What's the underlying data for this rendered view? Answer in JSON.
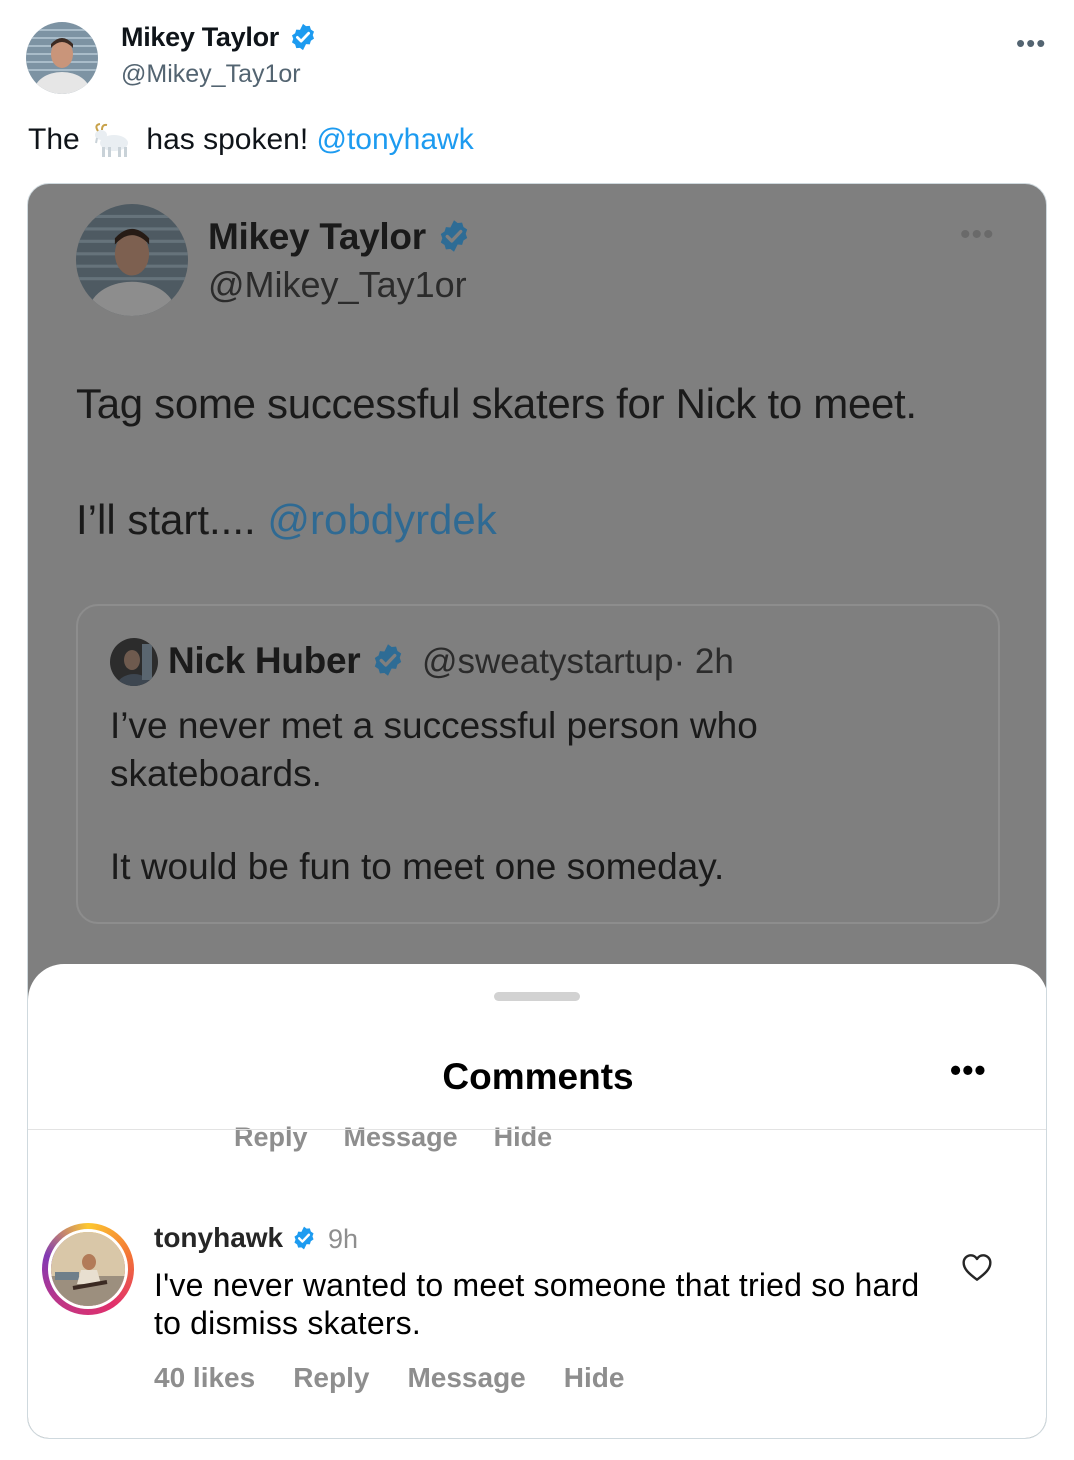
{
  "tweet": {
    "author_name": "Mikey Taylor",
    "author_handle": "@Mikey_Tay1or",
    "more_icon": "more-horizontal-icon",
    "text_before": "The",
    "emoji_icon": "goat-emoji-icon",
    "text_after": "has spoken!",
    "mention": "@tonyhawk",
    "colors": {
      "link": "#1d9bf0",
      "verified": "#1d9bf0",
      "secondary": "#536471"
    }
  },
  "screenshot": {
    "author_name": "Mikey Taylor",
    "author_handle": "@Mikey_Tay1or",
    "line1": "Tag some successful skaters for Nick to meet.",
    "line2_text": "I’ll start....",
    "line2_mention": "@robdyrdek",
    "quoted": {
      "author_name": "Nick Huber",
      "author_handle": "@sweatystartup",
      "time": "· 2h",
      "line1": "I’ve never met a successful person who skateboards.",
      "line2": "It would be fun to meet one someday."
    }
  },
  "comments_sheet": {
    "title": "Comments",
    "previous_actions": [
      "Reply",
      "Message",
      "Hide"
    ],
    "comment": {
      "username": "tonyhawk",
      "time": "9h",
      "text": "I've never wanted to meet someone that tried so hard to dismiss skaters.",
      "likes": "40 likes",
      "actions": [
        "Reply",
        "Message",
        "Hide"
      ]
    }
  }
}
